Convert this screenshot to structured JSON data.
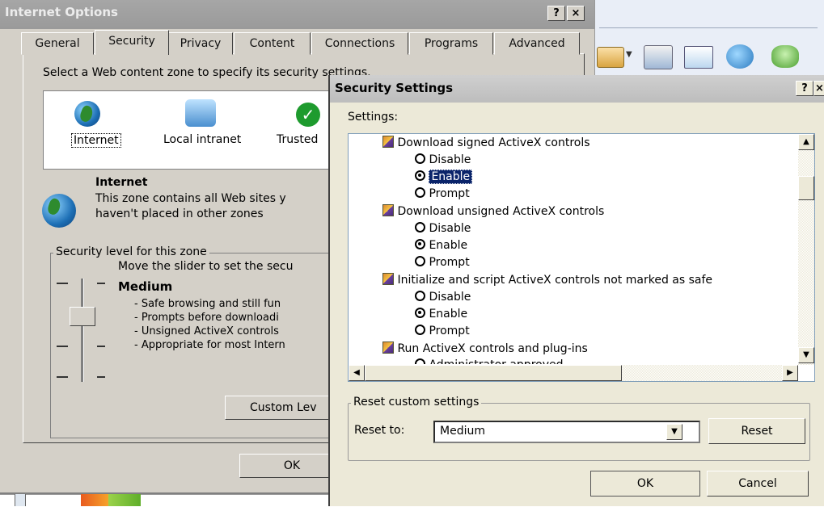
{
  "internet_options": {
    "title": "Internet Options",
    "help_btn": "?",
    "close_btn": "×",
    "tabs": [
      "General",
      "Security",
      "Privacy",
      "Content",
      "Connections",
      "Programs",
      "Advanced"
    ],
    "zone_prompt": "Select a Web content zone to specify its security settings.",
    "zones": [
      "Internet",
      "Local intranet",
      "Trusted"
    ],
    "zone_title": "Internet",
    "zone_desc_1": "This zone contains all Web sites y",
    "zone_desc_2": "haven't placed in other zones",
    "security_group_label": "Security level for this zone",
    "slider_hint": "Move the slider to set the secu",
    "level_name": "Medium",
    "level_points": [
      "- Safe browsing and still fun",
      "- Prompts before downloadi",
      "- Unsigned ActiveX controls",
      "- Appropriate for most Intern"
    ],
    "custom_level_btn": "Custom Lev",
    "ok_btn": "OK"
  },
  "security_settings": {
    "title": "Security Settings",
    "help_btn": "?",
    "close_btn": "×",
    "settings_label": "Settings:",
    "groups": [
      {
        "label": "Download signed ActiveX controls",
        "options": [
          {
            "label": "Disable",
            "checked": false,
            "highlight": false
          },
          {
            "label": "Enable",
            "checked": true,
            "highlight": true
          },
          {
            "label": "Prompt",
            "checked": false,
            "highlight": false
          }
        ]
      },
      {
        "label": "Download unsigned ActiveX controls",
        "options": [
          {
            "label": "Disable",
            "checked": false,
            "highlight": false
          },
          {
            "label": "Enable",
            "checked": true,
            "highlight": false
          },
          {
            "label": "Prompt",
            "checked": false,
            "highlight": false
          }
        ]
      },
      {
        "label": "Initialize and script ActiveX controls not marked as safe",
        "options": [
          {
            "label": "Disable",
            "checked": false,
            "highlight": false
          },
          {
            "label": "Enable",
            "checked": true,
            "highlight": false
          },
          {
            "label": "Prompt",
            "checked": false,
            "highlight": false
          }
        ]
      },
      {
        "label": "Run ActiveX controls and plug-ins",
        "options": [
          {
            "label": "Administrator approved",
            "checked": false,
            "highlight": false
          }
        ]
      }
    ],
    "reset_group_label": "Reset custom settings",
    "reset_to_label": "Reset to:",
    "reset_to_value": "Medium",
    "reset_btn": "Reset",
    "ok_btn": "OK",
    "cancel_btn": "Cancel"
  },
  "toolbar_icons": [
    "mail-icon",
    "print-icon",
    "edit-icon",
    "messenger-icon",
    "people-icon"
  ]
}
